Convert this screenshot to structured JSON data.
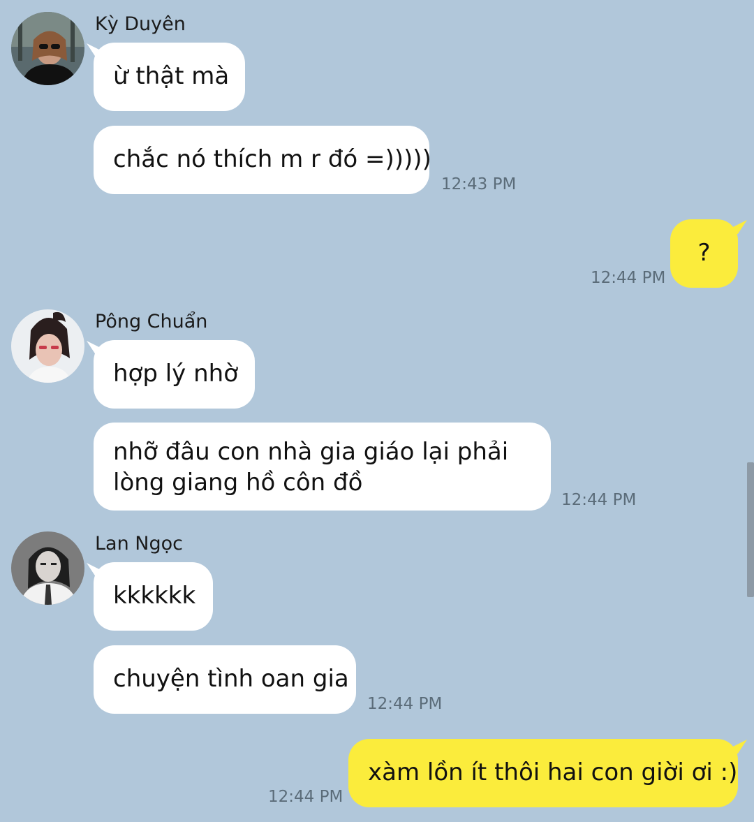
{
  "colors": {
    "background": "#b1c7da",
    "incoming_bubble": "#ffffff",
    "outgoing_bubble": "#fbec3c",
    "timestamp": "#5b6c79"
  },
  "messages": [
    {
      "sender": "Kỳ Duyên",
      "bubbles": [
        "ừ thật mà",
        "chắc nó thích m r đó =)))))"
      ],
      "time": "12:43 PM"
    },
    {
      "outgoing": true,
      "bubbles": [
        "?"
      ],
      "time": "12:44 PM"
    },
    {
      "sender": "Pông Chuẩn",
      "bubbles": [
        "hợp lý nhờ",
        "nhỡ đâu con nhà gia giáo lại phải\nlòng giang hồ côn đồ"
      ],
      "time": "12:44 PM"
    },
    {
      "sender": "Lan Ngọc",
      "bubbles": [
        "kkkkkk",
        "chuyện tình oan gia"
      ],
      "time": "12:44 PM"
    },
    {
      "outgoing": true,
      "bubbles": [
        "xàm lồn ít thôi hai con giời ơi :)"
      ],
      "time": "12:44 PM"
    }
  ]
}
